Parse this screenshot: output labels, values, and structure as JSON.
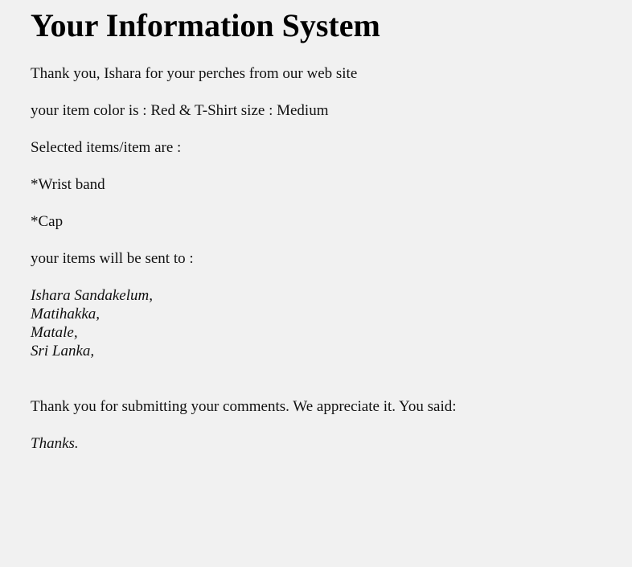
{
  "page": {
    "title": "Your Information System"
  },
  "greeting": {
    "prefix": "Thank you, ",
    "name": "Ishara",
    "suffix": " for your perches from our web site"
  },
  "item_details": {
    "color_label": "your item color is : ",
    "color": "Red",
    "joiner": " & ",
    "size_label": "T-Shirt size : ",
    "size": "Medium"
  },
  "selected": {
    "heading": "Selected items/item are :",
    "items": [
      "*Wrist band",
      "*Cap"
    ]
  },
  "shipping": {
    "heading": "your items will be sent to :",
    "address_lines": [
      "Ishara Sandakelum,",
      "Matihakka,",
      "Matale,",
      "Sri Lanka,"
    ]
  },
  "comments": {
    "intro": "Thank you for submitting your comments. We appreciate it. You said:",
    "text": "Thanks."
  }
}
